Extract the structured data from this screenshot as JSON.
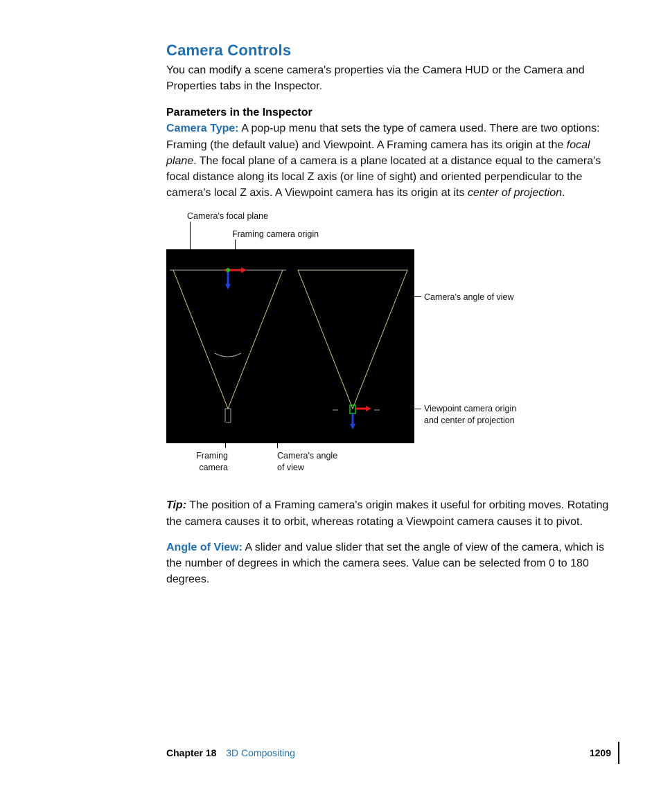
{
  "section_heading": "Camera Controls",
  "intro": "You can modify a scene camera's properties via the Camera HUD or the Camera and Properties tabs in the Inspector.",
  "sub_heading": "Parameters in the Inspector",
  "camera_type": {
    "label": "Camera Type:",
    "body_pre": "  A pop-up menu that sets the type of camera used. There are two options: Framing (the default value) and Viewpoint. A Framing camera has its origin at the ",
    "focal_plane": "focal plane",
    "body_mid": ". The focal plane of a camera is a plane located at a distance equal to the camera's focal distance along its local Z axis (or line of sight) and oriented perpendicular to the camera's local Z axis. A Viewpoint camera has its origin at its ",
    "center_proj": "center of projection",
    "body_end": "."
  },
  "figure": {
    "callout_focal_plane": "Camera's focal plane",
    "callout_framing_origin": "Framing camera origin",
    "callout_angle_right": "Camera's angle of view",
    "callout_viewpoint_origin_l1": "Viewpoint camera origin",
    "callout_viewpoint_origin_l2": "and center of projection",
    "callout_framing_camera_l1": "Framing",
    "callout_framing_camera_l2": "camera",
    "callout_angle_bottom_l1": "Camera's angle",
    "callout_angle_bottom_l2": "of view"
  },
  "tip": {
    "label": "Tip:",
    "body": "  The position of a Framing camera's origin makes it useful for orbiting moves. Rotating the camera causes it to orbit, whereas rotating a Viewpoint camera causes it to pivot."
  },
  "angle_of_view": {
    "label": "Angle of View:",
    "body": "  A slider and value slider that set the angle of view of the camera, which is the number of degrees in which the camera sees. Value can be selected from 0 to 180 degrees."
  },
  "footer": {
    "chapter_label": "Chapter 18",
    "chapter_title": "3D Compositing",
    "page_number": "1209"
  }
}
